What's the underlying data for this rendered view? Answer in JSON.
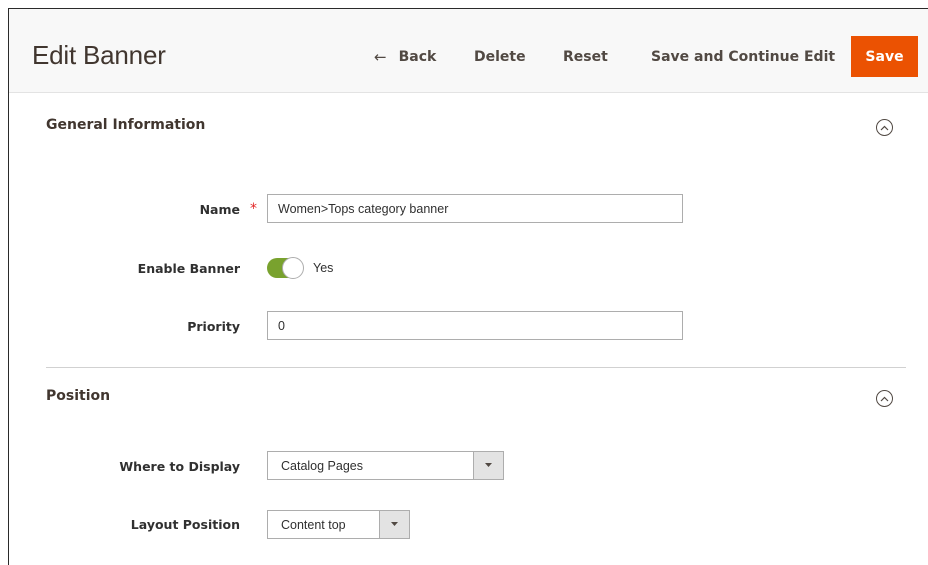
{
  "header": {
    "title": "Edit Banner",
    "back_label": "Back",
    "back_icon": "arrow-left-icon",
    "delete_label": "Delete",
    "reset_label": "Reset",
    "save_continue_label": "Save and Continue Edit",
    "save_label": "Save"
  },
  "general": {
    "title": "General Information",
    "name_label": "Name",
    "name_required": "*",
    "name_value": "Women>Tops category banner",
    "enable_label": "Enable Banner",
    "enable_value": "Yes",
    "priority_label": "Priority",
    "priority_value": "0"
  },
  "position": {
    "title": "Position",
    "where_label": "Where to Display",
    "where_value": "Catalog Pages",
    "layout_label": "Layout Position",
    "layout_value": "Content top"
  },
  "colors": {
    "accent": "#eb5202",
    "toggle_on": "#79a22e",
    "required": "#e22626"
  }
}
